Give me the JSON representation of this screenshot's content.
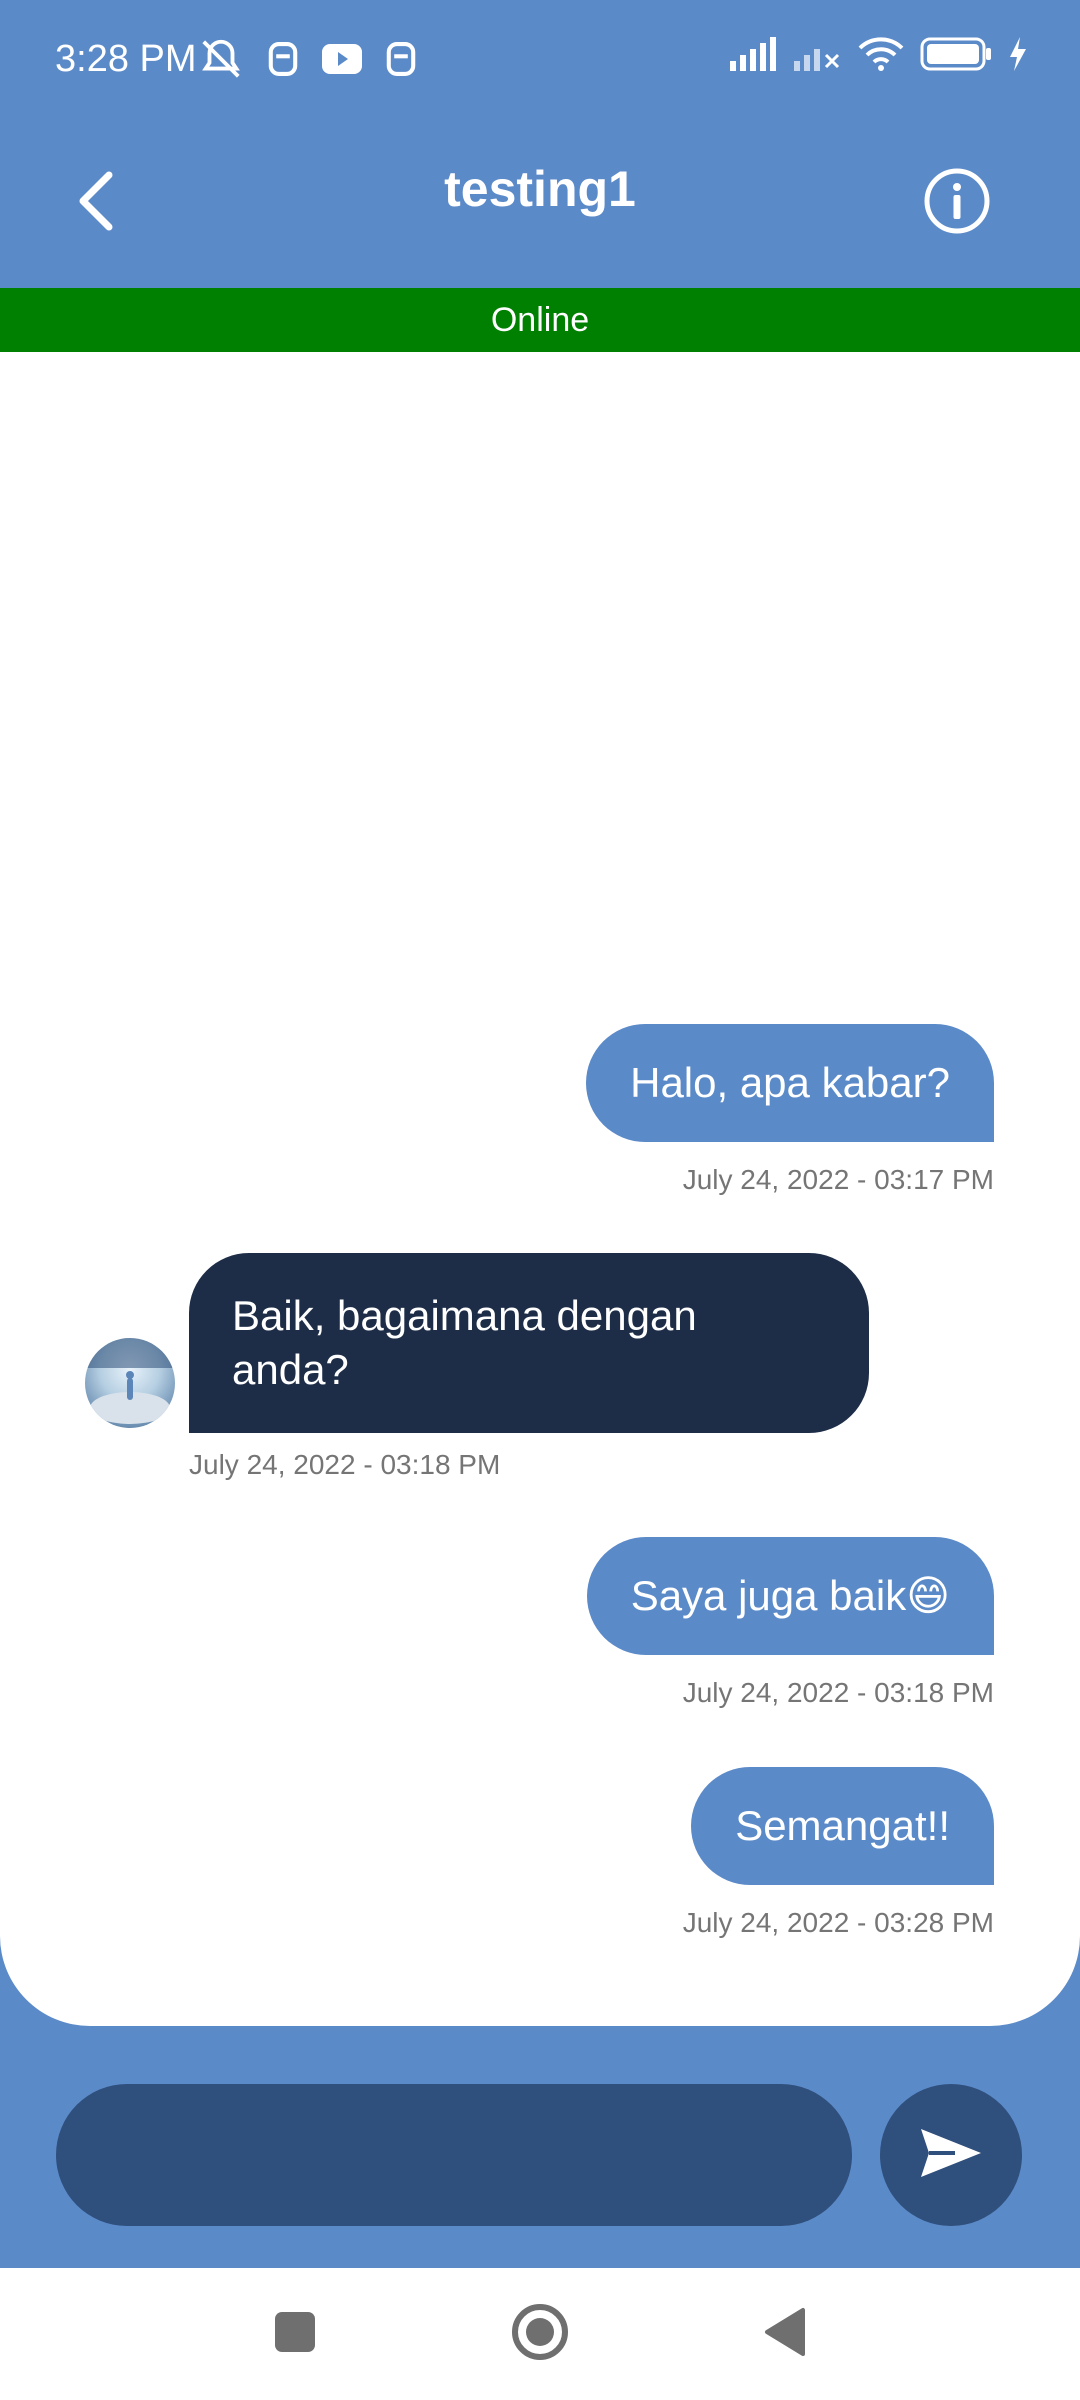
{
  "status_bar": {
    "time": "3:28 PM",
    "icons": [
      "mute-alarm-icon",
      "app-notification-icon",
      "youtube-icon",
      "app-notification-icon",
      "signal-icon",
      "signal-no-service-icon",
      "wifi-icon",
      "battery-icon",
      "charging-icon"
    ]
  },
  "header": {
    "title": "testing1",
    "back_icon": "chevron-left-icon",
    "info_icon": "info-icon"
  },
  "presence": {
    "status": "Online",
    "color": "#008000"
  },
  "messages": [
    {
      "direction": "outgoing",
      "text": "Halo, apa kabar?",
      "timestamp": "July 24, 2022 - 03:17 PM"
    },
    {
      "direction": "incoming",
      "text": "Baik, bagaimana dengan anda?",
      "timestamp": "July 24, 2022 - 03:18 PM"
    },
    {
      "direction": "outgoing",
      "text": "Saya juga baik😄",
      "timestamp": "July 24, 2022 - 03:18 PM"
    },
    {
      "direction": "outgoing",
      "text": "Semangat!!",
      "timestamp": "July 24, 2022 - 03:28 PM"
    }
  ],
  "composer": {
    "value": "",
    "placeholder": "",
    "send_icon": "send-icon"
  },
  "nav": {
    "icons": [
      "recents-square-icon",
      "home-circle-icon",
      "back-triangle-icon"
    ]
  },
  "colors": {
    "primary": "#5b8ac9",
    "incoming_bubble": "#1e2d47",
    "composer": "#2f4f7c",
    "online": "#008000"
  }
}
